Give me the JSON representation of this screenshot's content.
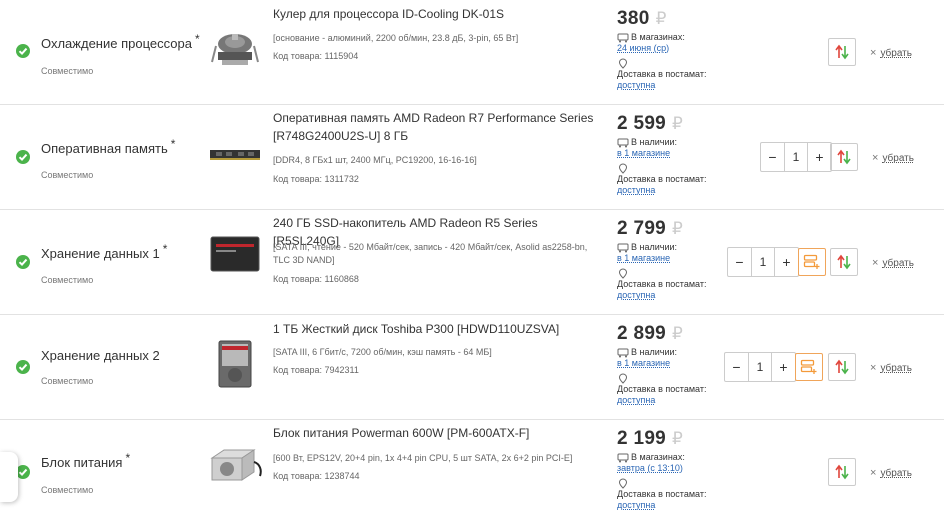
{
  "rows": [
    {
      "category": "Охлаждение процессора",
      "star": "*",
      "compat": "Совместимо",
      "title": "Кулер для процессора ID-Cooling DK-01S",
      "specs": "[основание - алюминий, 2200 об/мин, 23.8 дБ, 3-pin, 65 Вт]",
      "code": "Код товара: 1115904",
      "price": "380",
      "currency": "₽",
      "avail_label": "В магазинах:",
      "avail_value": "24 июня (ср)",
      "delivery_label": "Доставка в постамат:",
      "delivery_value": "доступна",
      "remove": "убрать"
    },
    {
      "category": "Оперативная память",
      "star": "*",
      "compat": "Совместимо",
      "title": "Оперативная память AMD Radeon R7 Performance Series [R748G2400U2S-U] 8 ГБ",
      "specs": "[DDR4, 8 ГБx1 шт, 2400 МГц, PC19200, 16-16-16]",
      "code": "Код товара: 1311732",
      "price": "2 599",
      "currency": "₽",
      "avail_label": "В наличии:",
      "avail_value": "в 1 магазине",
      "delivery_label": "Доставка в постамат:",
      "delivery_value": "доступна",
      "qty_minus": "−",
      "qty": "1",
      "qty_plus": "+",
      "remove": "убрать"
    },
    {
      "category": "Хранение данных 1",
      "star": "*",
      "compat": "Совместимо",
      "title": "240 ГБ SSD-накопитель AMD Radeon R5 Series [R5SL240G]",
      "specs": "[SATA III, чтение - 520 Мбайт/сек, запись - 420 Мбайт/сек, Asolid as2258-bn, TLC 3D NAND]",
      "code": "Код товара: 1160868",
      "price": "2 799",
      "currency": "₽",
      "avail_label": "В наличии:",
      "avail_value": "в 1 магазине",
      "delivery_label": "Доставка в постамат:",
      "delivery_value": "доступна",
      "qty_minus": "−",
      "qty": "1",
      "qty_plus": "+",
      "remove": "убрать"
    },
    {
      "category": "Хранение данных 2",
      "star": "",
      "compat": "Совместимо",
      "title": "1 ТБ Жесткий диск Toshiba P300 [HDWD110UZSVA]",
      "specs": "[SATA III, 6 Гбит/с, 7200 об/мин, кэш память - 64 МБ]",
      "code": "Код товара: 7942311",
      "price": "2 899",
      "currency": "₽",
      "avail_label": "В наличии:",
      "avail_value": "в 1 магазине",
      "delivery_label": "Доставка в постамат:",
      "delivery_value": "доступна",
      "qty_minus": "−",
      "qty": "1",
      "qty_plus": "+",
      "remove": "убрать"
    },
    {
      "category": "Блок питания",
      "star": "*",
      "compat": "Совместимо",
      "title": "Блок питания Powerman 600W [PM-600ATX-F]",
      "specs": "[600 Вт, EPS12V, 20+4 pin, 1x 4+4 pin CPU, 5 шт SATA, 2x 6+2 pin PCI-E]",
      "code": "Код товара: 1238744",
      "price": "2 199",
      "currency": "₽",
      "avail_label": "В магазинах:",
      "avail_value": "завтра (с 13:10)",
      "delivery_label": "Доставка в постамат:",
      "delivery_value": "доступна",
      "remove": "убрать"
    }
  ],
  "colors": {
    "ok_green": "#4bb34b",
    "link_blue": "#2a66b5",
    "sort_red": "#e0463c",
    "sort_green": "#4bb34b",
    "accent_orange": "#f39a3a"
  },
  "icons": [
    "check-icon",
    "store-icon",
    "location-pin-icon",
    "sort-arrows-icon",
    "compare-icon",
    "close-icon"
  ]
}
